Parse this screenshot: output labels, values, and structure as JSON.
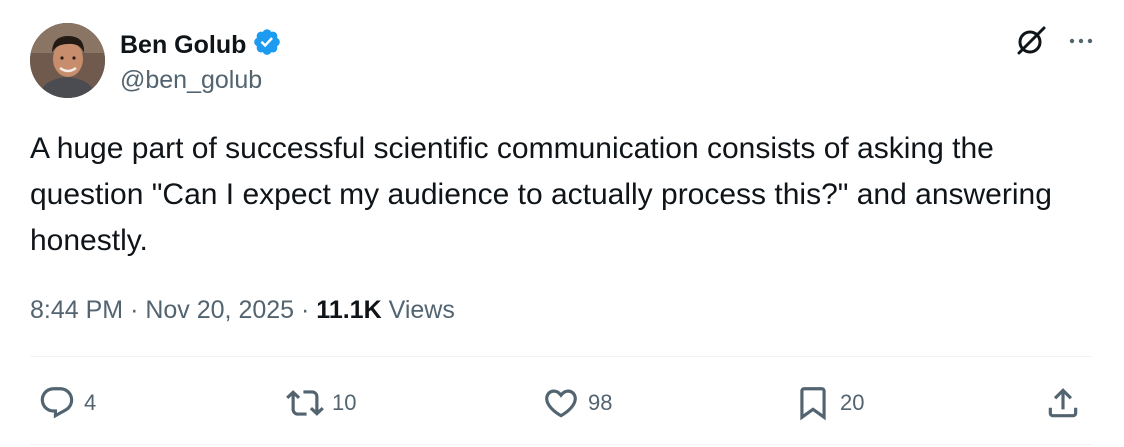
{
  "author": {
    "name": "Ben Golub",
    "handle": "@ben_golub",
    "verified": true,
    "badge_color": "#1d9bf0"
  },
  "tweet": {
    "text": "A huge part of successful scientific communication consists of asking the question \"Can I expect my audience to actually process this?\" and answering honestly."
  },
  "meta": {
    "time": "8:44 PM",
    "separator": "·",
    "date": "Nov 20, 2025",
    "views_count": "11.1K",
    "views_label": "Views"
  },
  "actions": {
    "replies": "4",
    "reposts": "10",
    "likes": "98",
    "bookmarks": "20"
  },
  "icons": {
    "top_right": [
      "grok-icon",
      "more-icon"
    ],
    "actions": [
      "reply-icon",
      "repost-icon",
      "like-icon",
      "bookmark-icon",
      "share-icon"
    ]
  },
  "colors": {
    "text_primary": "#0f1419",
    "text_secondary": "#536471",
    "divider": "#eff3f4"
  }
}
